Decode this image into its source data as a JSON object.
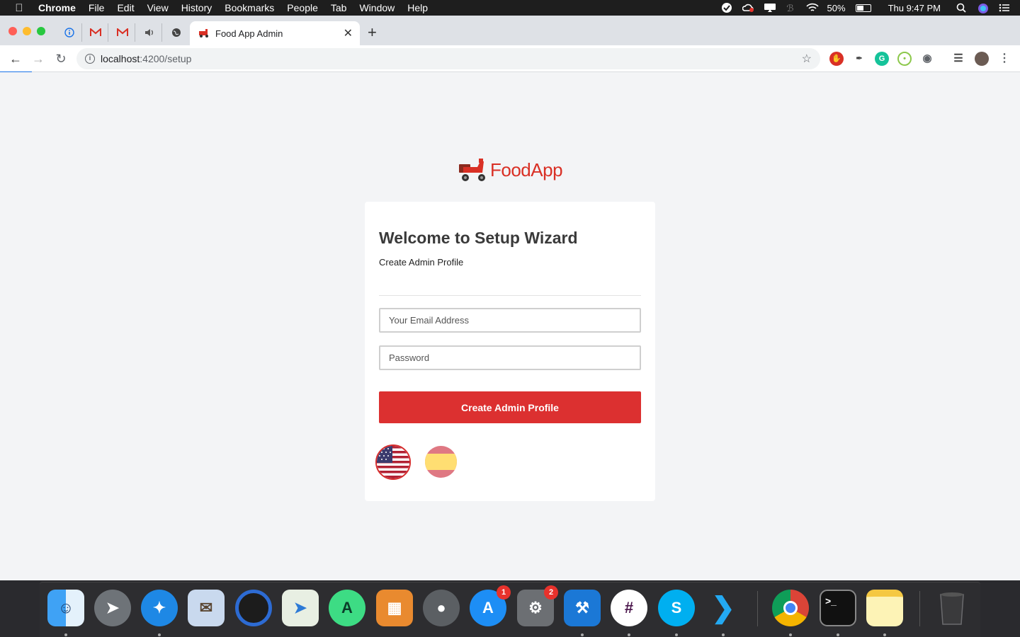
{
  "menubar": {
    "app": "Chrome",
    "items": [
      "File",
      "Edit",
      "View",
      "History",
      "Bookmarks",
      "People",
      "Tab",
      "Window",
      "Help"
    ],
    "battery": "50%",
    "clock": "Thu 9:47 PM"
  },
  "tabs": {
    "active_title": "Food App Admin",
    "new_tab": "+"
  },
  "toolbar": {
    "url_host": "localhost",
    "url_path": ":4200/setup"
  },
  "logo": {
    "brand": "FoodApp"
  },
  "form": {
    "title": "Welcome to Setup Wizard",
    "subtitle": "Create Admin Profile",
    "email_placeholder": "Your Email Address",
    "password_placeholder": "Password",
    "submit_label": "Create Admin Profile"
  },
  "languages": [
    "en-US",
    "es"
  ],
  "dock": {
    "appstore_badge": "1",
    "settings_badge": "2"
  },
  "colors": {
    "accent": "#dc3030",
    "brand": "#d93025"
  }
}
